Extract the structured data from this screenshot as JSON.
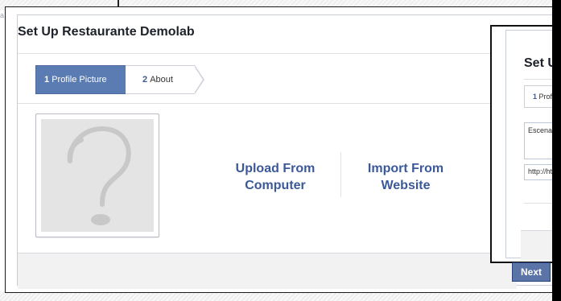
{
  "background_page": {
    "crumb_text": "a"
  },
  "main_dialog": {
    "title": "Set Up Restaurante Demolab",
    "steps": [
      {
        "number": "1",
        "label": "Profile Picture",
        "active": true
      },
      {
        "number": "2",
        "label": "About",
        "active": false
      }
    ],
    "profile_picture_placeholder": "question-mark-icon",
    "actions": {
      "upload": "Upload From Computer",
      "import": "Import From Website"
    }
  },
  "second_dialog": {
    "title": "Set U",
    "step_label_number": "1",
    "step_label": "Profil",
    "textarea_value": "Escenari",
    "url_value": "http://ht"
  },
  "footer": {
    "next_label": "Next"
  },
  "colors": {
    "accent_blue": "#5b7bb3",
    "link_blue": "#3b5998",
    "button_blue": "#5b74a8"
  }
}
